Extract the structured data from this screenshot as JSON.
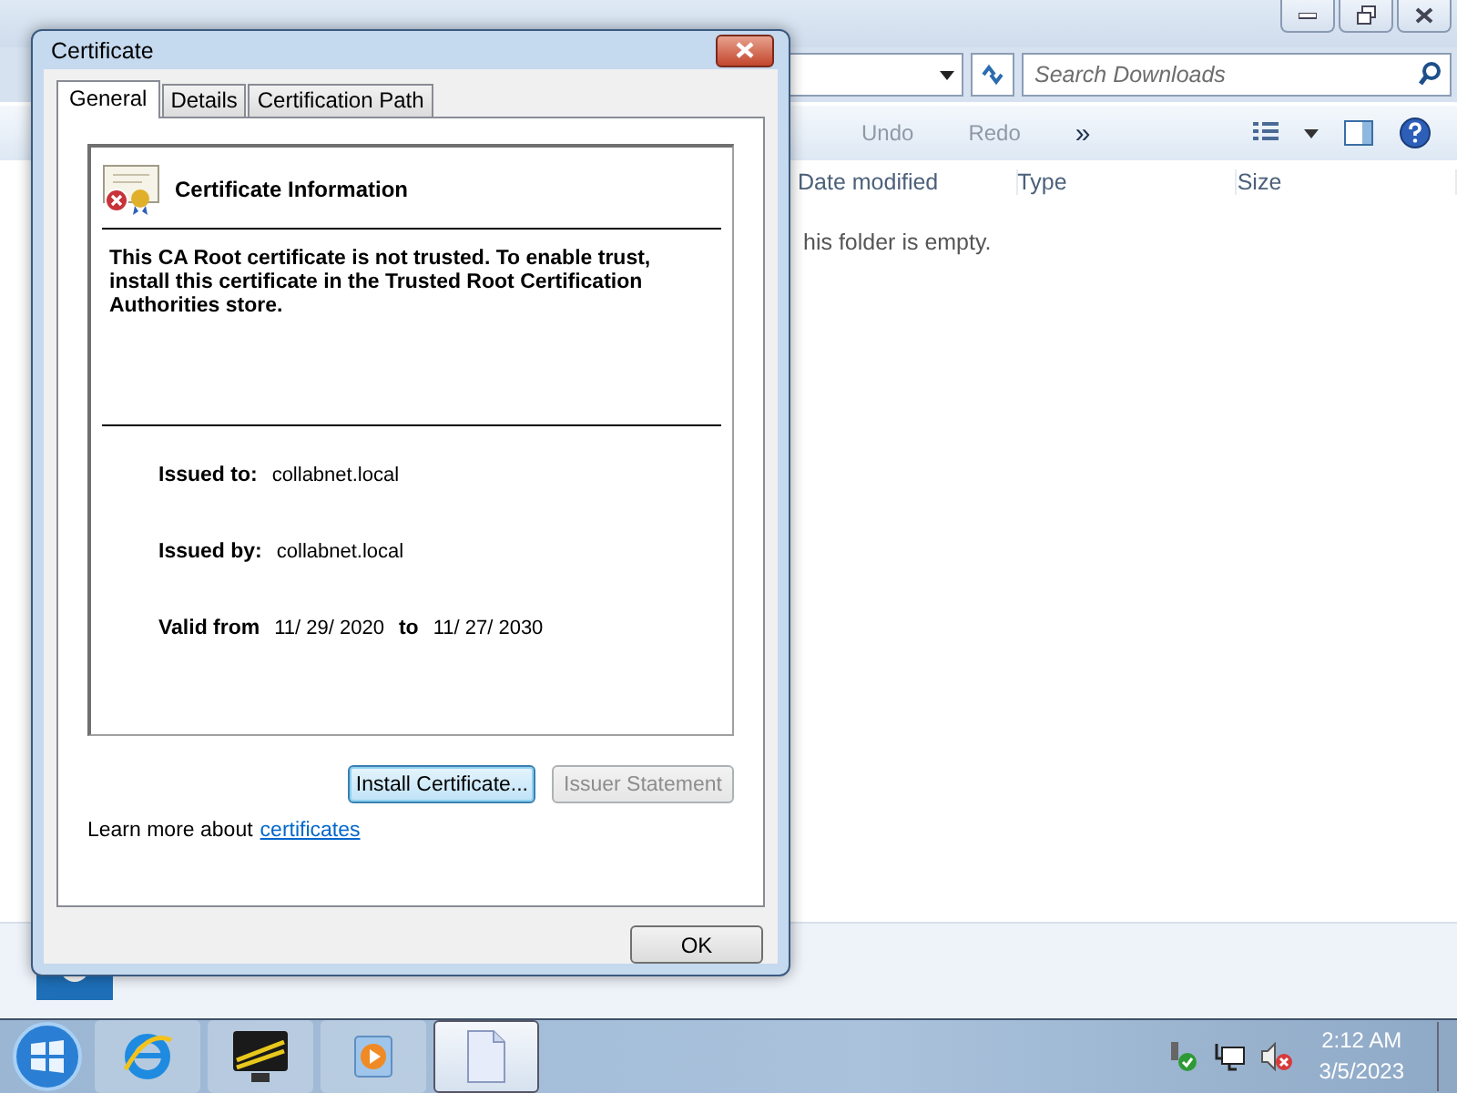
{
  "explorer": {
    "search": {
      "placeholder": "Search Downloads"
    },
    "toolbar": [
      {
        "label": "Undo",
        "disabled": true
      },
      {
        "label": "Redo",
        "disabled": true
      },
      {
        "label": "»",
        "disabled": false
      }
    ],
    "columns": [
      "Date modified",
      "Type",
      "Size"
    ],
    "empty_message": "his folder is empty."
  },
  "dialog": {
    "title": "Certificate",
    "tabs": [
      {
        "label": "General",
        "selected": true
      },
      {
        "label": "Details",
        "selected": false
      },
      {
        "label": "Certification Path",
        "selected": false
      }
    ],
    "heading": "Certificate Information",
    "message": "This CA Root certificate is not trusted. To enable trust, install this certificate in the Trusted Root Certification Authorities store.",
    "fields": [
      {
        "label": "Issued to:",
        "value": "collabnet.local"
      },
      {
        "label": "Issued by:",
        "value": "collabnet.local"
      }
    ],
    "validity": {
      "label": "Valid from",
      "from": "11/ 29/ 2020",
      "to_label": "to",
      "to": "11/ 27/ 2030"
    },
    "buttons": [
      {
        "label": "Install Certificate...",
        "focused": true,
        "disabled": false
      },
      {
        "label": "Issuer Statement",
        "focused": false,
        "disabled": true
      }
    ],
    "learn_more": {
      "text": "Learn more about",
      "link": "certificates"
    },
    "ok": "OK"
  },
  "taskbar": {
    "apps": [
      {
        "kind": "browser",
        "active": false
      },
      {
        "kind": "monitor",
        "active": false
      },
      {
        "kind": "media",
        "active": false
      },
      {
        "kind": "document",
        "active": true
      }
    ],
    "clock": {
      "time": "2:12 AM",
      "date": "3/5/2023"
    }
  }
}
